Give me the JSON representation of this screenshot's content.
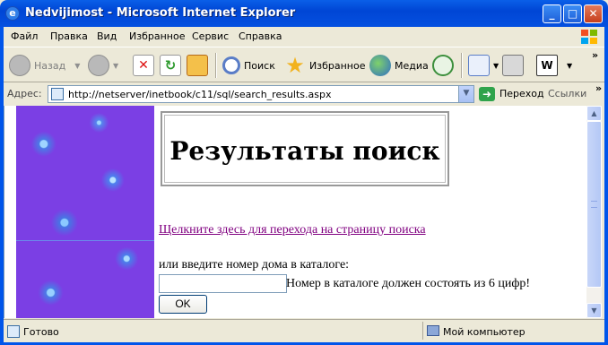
{
  "window": {
    "title": "Nedvijimost - Microsoft Internet Explorer"
  },
  "menu": [
    "Файл",
    "Правка",
    "Вид",
    "Избранное",
    "Сервис",
    "Справка"
  ],
  "toolbar": {
    "back": "Назад",
    "search": "Поиск",
    "favorites": "Избранное",
    "media": "Медиа"
  },
  "address": {
    "label": "Адрес:",
    "url": "http://netserver/inetbook/c11/sql/search_results.aspx",
    "go": "Переход",
    "links": "Ссылки"
  },
  "page": {
    "heading": "Результаты поиск",
    "search_link": "Щелкните здесь для перехода на страницу поиска",
    "hint": "или введите номер дома в каталоге:",
    "input_value": "",
    "note": "Номер в каталоге должен состоять из 6 цифр!",
    "ok_label": "OK"
  },
  "status": {
    "text": "Готово",
    "zone": "Мой компьютер"
  }
}
